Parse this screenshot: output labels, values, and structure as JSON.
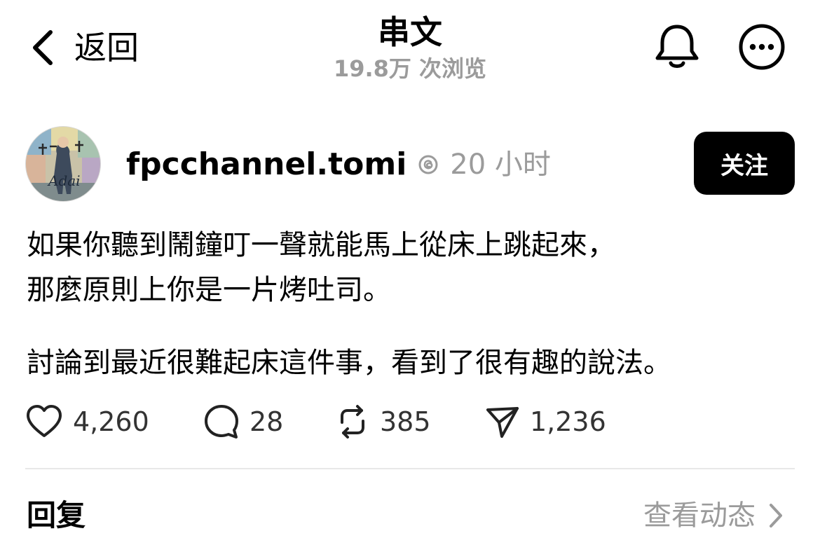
{
  "header": {
    "back_label": "返回",
    "title": "串文",
    "view_count": "19.8万 次浏览"
  },
  "post": {
    "author": {
      "username": "fpcchannel.tomi",
      "avatar_text": "Adai",
      "time": "20 小时"
    },
    "follow_label": "关注",
    "paragraphs": [
      {
        "lines": [
          "如果你聽到鬧鐘叮一聲就能馬上從床上跳起來，",
          "那麼原則上你是一片烤吐司。"
        ]
      },
      {
        "lines": [
          "討論到最近很難起床這件事，看到了很有趣的說法。"
        ]
      }
    ],
    "actions": {
      "likes": "4,260",
      "replies": "28",
      "reposts": "385",
      "shares": "1,236"
    }
  },
  "footer": {
    "replies_title": "回复",
    "activity_label": "查看动态"
  },
  "icons": {
    "back": "chevron-left-icon",
    "bell": "bell-icon",
    "more": "more-horizontal-icon",
    "verified": "threads-badge-icon",
    "like": "heart-icon",
    "reply": "comment-icon",
    "repost": "repost-icon",
    "share": "send-icon",
    "activity": "chevron-right-icon"
  },
  "colors": {
    "text": "#000000",
    "muted": "#9b9b9b",
    "follow_bg": "#000000",
    "divider": "#e8e8e8"
  }
}
